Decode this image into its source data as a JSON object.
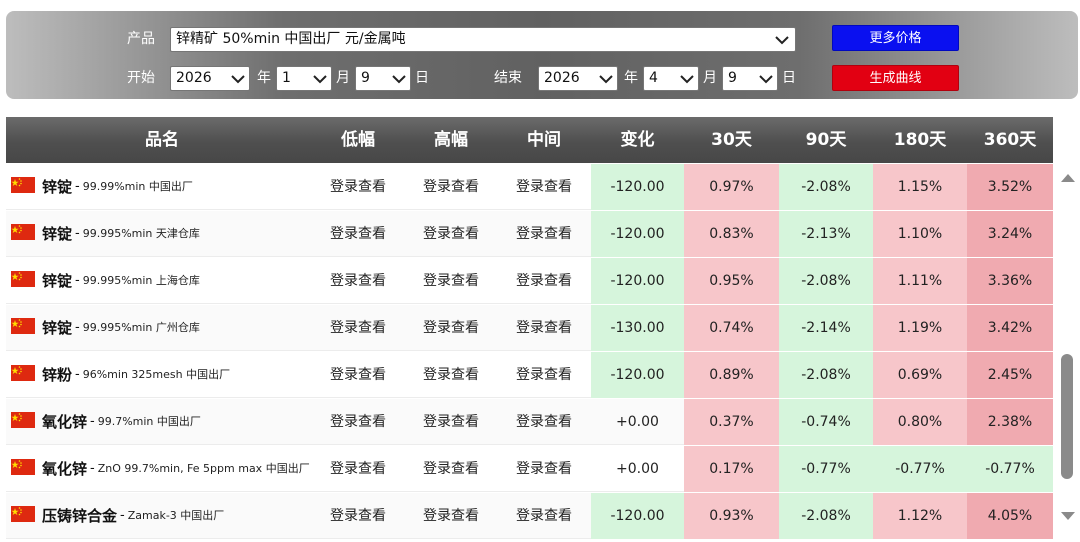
{
  "filters": {
    "product_label": "产品",
    "product_value": "锌精矿 50%min 中国出厂 元/金属吨",
    "more_prices_label": "更多价格",
    "start_label": "开始",
    "end_label": "结束",
    "start": {
      "year": "2026",
      "month": "1",
      "day": "9"
    },
    "end": {
      "year": "2026",
      "month": "4",
      "day": "9"
    },
    "unit_year": "年",
    "unit_month": "月",
    "unit_day": "日",
    "generate_label": "生成曲线",
    "colors": {
      "more_prices_button": "#0a10f0",
      "generate_button": "#e20012"
    }
  },
  "table": {
    "headers": [
      "品名",
      "低幅",
      "高幅",
      "中间",
      "变化",
      "30天",
      "90天",
      "180天",
      "360天"
    ],
    "icons": {
      "flag": "china-flag-icon"
    },
    "colors": {
      "up": "#f7c6ca",
      "up_strong": "#f0aab0",
      "down": "#d6f5dc"
    },
    "rows": [
      {
        "name": "锌锭",
        "spec": "99.99%min 中国出厂",
        "low": "登录查看",
        "high": "登录查看",
        "mid": "登录查看",
        "change": "-120.00",
        "d30": "0.97%",
        "d90": "-2.08%",
        "d180": "1.15%",
        "d360": "3.52%"
      },
      {
        "name": "锌锭",
        "spec": "99.995%min 天津仓库",
        "low": "登录查看",
        "high": "登录查看",
        "mid": "登录查看",
        "change": "-120.00",
        "d30": "0.83%",
        "d90": "-2.13%",
        "d180": "1.10%",
        "d360": "3.24%"
      },
      {
        "name": "锌锭",
        "spec": "99.995%min 上海仓库",
        "low": "登录查看",
        "high": "登录查看",
        "mid": "登录查看",
        "change": "-120.00",
        "d30": "0.95%",
        "d90": "-2.08%",
        "d180": "1.11%",
        "d360": "3.36%"
      },
      {
        "name": "锌锭",
        "spec": "99.995%min 广州仓库",
        "low": "登录查看",
        "high": "登录查看",
        "mid": "登录查看",
        "change": "-130.00",
        "d30": "0.74%",
        "d90": "-2.14%",
        "d180": "1.19%",
        "d360": "3.42%"
      },
      {
        "name": "锌粉",
        "spec": "96%min 325mesh 中国出厂",
        "low": "登录查看",
        "high": "登录查看",
        "mid": "登录查看",
        "change": "-120.00",
        "d30": "0.89%",
        "d90": "-2.08%",
        "d180": "0.69%",
        "d360": "2.45%"
      },
      {
        "name": "氧化锌",
        "spec": "99.7%min 中国出厂",
        "low": "登录查看",
        "high": "登录查看",
        "mid": "登录查看",
        "change": "+0.00",
        "d30": "0.37%",
        "d90": "-0.74%",
        "d180": "0.80%",
        "d360": "2.38%"
      },
      {
        "name": "氧化锌",
        "spec": "ZnO 99.7%min, Fe 5ppm max 中国出厂",
        "low": "登录查看",
        "high": "登录查看",
        "mid": "登录查看",
        "change": "+0.00",
        "d30": "0.17%",
        "d90": "-0.77%",
        "d180": "-0.77%",
        "d360": "-0.77%"
      },
      {
        "name": "压铸锌合金",
        "spec": "Zamak-3 中国出厂",
        "low": "登录查看",
        "high": "登录查看",
        "mid": "登录查看",
        "change": "-120.00",
        "d30": "0.93%",
        "d90": "-2.08%",
        "d180": "1.12%",
        "d360": "4.05%"
      }
    ]
  }
}
